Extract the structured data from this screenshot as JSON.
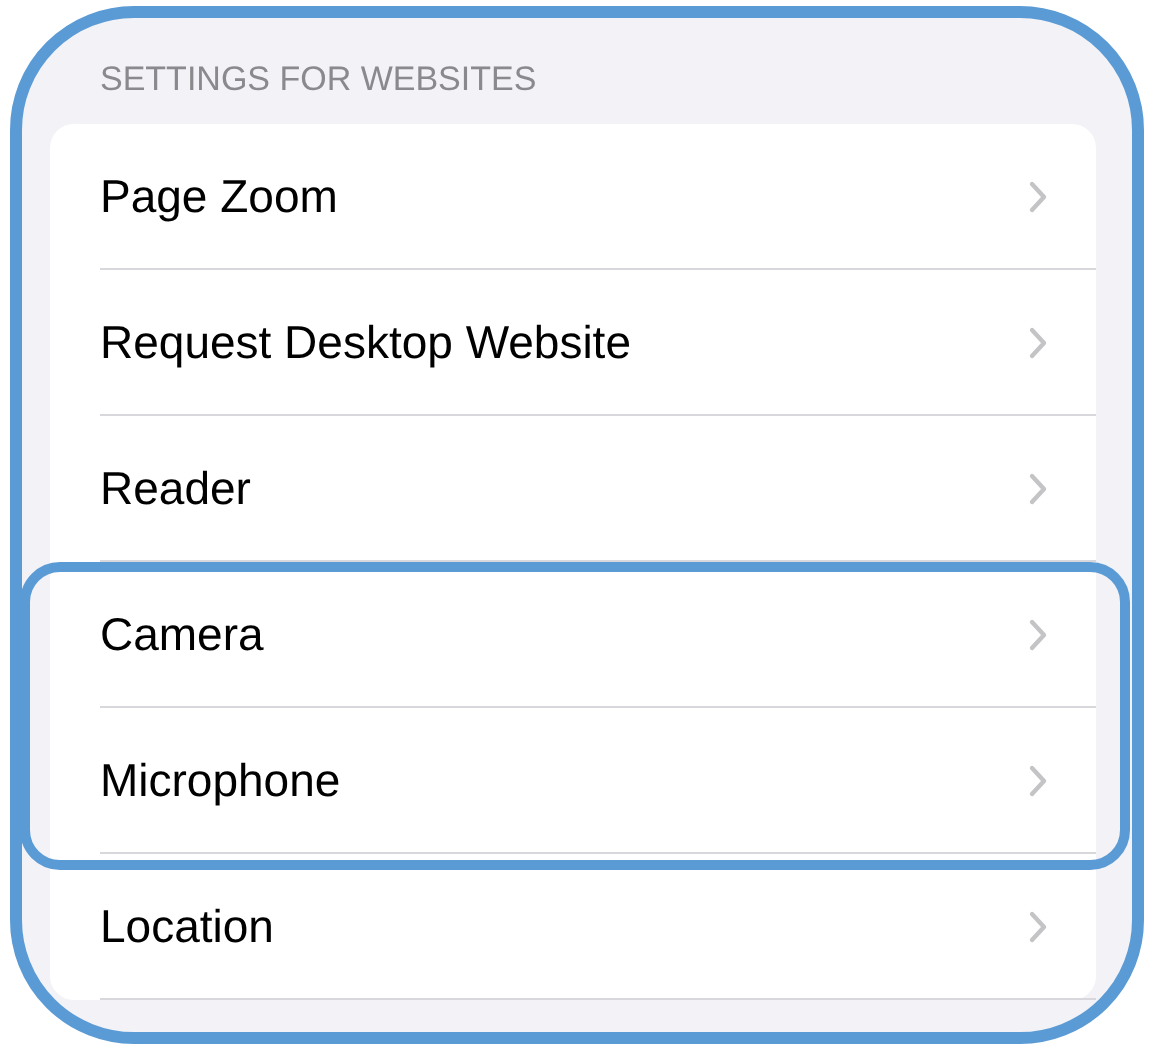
{
  "section_header": "SETTINGS FOR WEBSITES",
  "rows": [
    {
      "label": "Page Zoom",
      "highlighted": false
    },
    {
      "label": "Request Desktop Website",
      "highlighted": false
    },
    {
      "label": "Reader",
      "highlighted": false
    },
    {
      "label": "Camera",
      "highlighted": true
    },
    {
      "label": "Microphone",
      "highlighted": true
    },
    {
      "label": "Location",
      "highlighted": false
    }
  ]
}
